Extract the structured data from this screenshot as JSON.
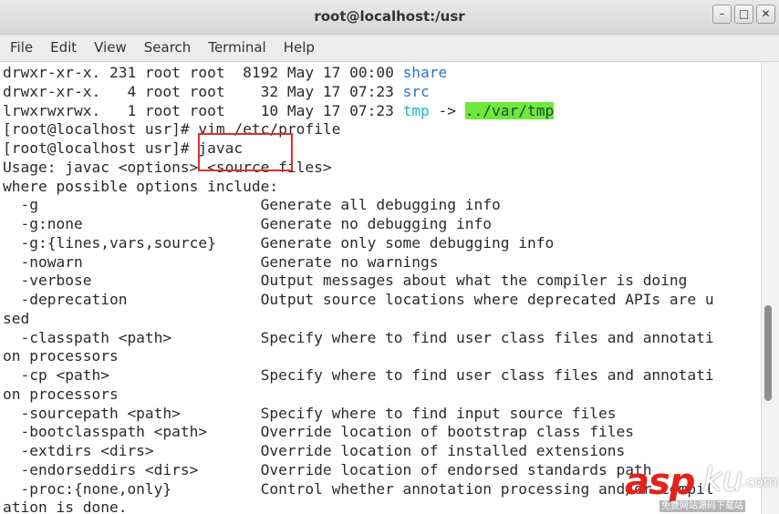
{
  "window": {
    "title": "root@localhost:/usr",
    "controls": {
      "minimize": "–",
      "maximize": "□",
      "close": "✕"
    }
  },
  "menubar": [
    "File",
    "Edit",
    "View",
    "Search",
    "Terminal",
    "Help"
  ],
  "terminal": {
    "lines": [
      {
        "segments": [
          {
            "text": "drwxr-xr-x. 231 root root  8192 May 17 00:00 "
          },
          {
            "text": "share",
            "style": "dir"
          }
        ]
      },
      {
        "segments": [
          {
            "text": "drwxr-xr-x.   4 root root    32 May 17 07:23 "
          },
          {
            "text": "src",
            "style": "dir"
          }
        ]
      },
      {
        "segments": [
          {
            "text": "lrwxrwxrwx.   1 root root    10 May 17 07:23 "
          },
          {
            "text": "tmp",
            "style": "lnk"
          },
          {
            "text": " -> "
          },
          {
            "text": "../var/tmp",
            "style": "hl"
          }
        ]
      },
      {
        "segments": [
          {
            "text": "[root@localhost usr]# vim /etc/profile"
          }
        ]
      },
      {
        "segments": [
          {
            "text": "[root@localhost usr]# javac"
          }
        ]
      },
      {
        "segments": [
          {
            "text": "Usage: javac <options> <source files>"
          }
        ]
      },
      {
        "segments": [
          {
            "text": "where possible options include:"
          }
        ]
      },
      {
        "segments": [
          {
            "text": "  -g                         Generate all debugging info"
          }
        ]
      },
      {
        "segments": [
          {
            "text": "  -g:none                    Generate no debugging info"
          }
        ]
      },
      {
        "segments": [
          {
            "text": "  -g:{lines,vars,source}     Generate only some debugging info"
          }
        ]
      },
      {
        "segments": [
          {
            "text": "  -nowarn                    Generate no warnings"
          }
        ]
      },
      {
        "segments": [
          {
            "text": "  -verbose                   Output messages about what the compiler is doing"
          }
        ]
      },
      {
        "segments": [
          {
            "text": "  -deprecation               Output source locations where deprecated APIs are u"
          }
        ]
      },
      {
        "segments": [
          {
            "text": "sed"
          }
        ]
      },
      {
        "segments": [
          {
            "text": "  -classpath <path>          Specify where to find user class files and annotati"
          }
        ]
      },
      {
        "segments": [
          {
            "text": "on processors"
          }
        ]
      },
      {
        "segments": [
          {
            "text": "  -cp <path>                 Specify where to find user class files and annotati"
          }
        ]
      },
      {
        "segments": [
          {
            "text": "on processors"
          }
        ]
      },
      {
        "segments": [
          {
            "text": "  -sourcepath <path>         Specify where to find input source files"
          }
        ]
      },
      {
        "segments": [
          {
            "text": "  -bootclasspath <path>      Override location of bootstrap class files"
          }
        ]
      },
      {
        "segments": [
          {
            "text": "  -extdirs <dirs>            Override location of installed extensions"
          }
        ]
      },
      {
        "segments": [
          {
            "text": "  -endorseddirs <dirs>       Override location of endorsed standards path"
          }
        ]
      },
      {
        "segments": [
          {
            "text": "  -proc:{none,only}          Control whether annotation processing and/or compil"
          }
        ]
      },
      {
        "segments": [
          {
            "text": "ation is done."
          }
        ]
      }
    ]
  },
  "watermark": {
    "brand": "asp",
    "suffix": "ku",
    "domain": ".com",
    "tagline": "免费网站源码下载站"
  },
  "colors": {
    "directory": "#2a6fd6",
    "symlink": "#12b8c9",
    "symlink_target_bg": "#6ee83a",
    "annotation_box": "#e0302c"
  }
}
